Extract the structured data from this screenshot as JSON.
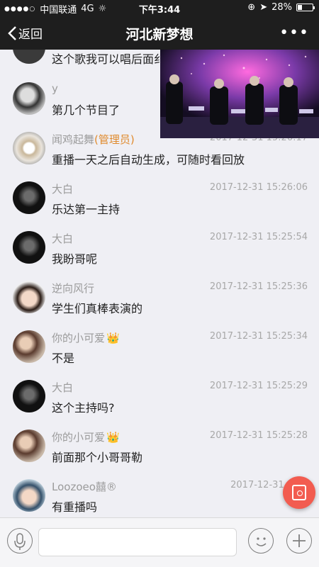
{
  "status_bar": {
    "carrier": "中国联通",
    "network": "4G",
    "time": "下午3:44",
    "battery": "28%",
    "battery_fraction": 0.28
  },
  "nav": {
    "back_label": "返回",
    "title": "河北新梦想",
    "more_label": "•••"
  },
  "messages": [
    {
      "sender": "",
      "admin_tag": "",
      "time": "",
      "text": "这个歌我可以唱后面纟"
    },
    {
      "sender": "y",
      "admin_tag": "",
      "time": "",
      "text": "第几个节目了"
    },
    {
      "sender": "闻鸡起舞",
      "admin_tag": "(管理员)",
      "time": "2017-12-31 15:26:17",
      "text": "重播一天之后自动生成，可随时看回放"
    },
    {
      "sender": "大白",
      "admin_tag": "",
      "time": "2017-12-31 15:26:06",
      "text": "乐达第一主持"
    },
    {
      "sender": "大白",
      "admin_tag": "",
      "time": "2017-12-31 15:25:54",
      "text": "我盼哥呢"
    },
    {
      "sender": "逆向风行",
      "admin_tag": "",
      "time": "2017-12-31 15:25:36",
      "text": "学生们真棒表演的"
    },
    {
      "sender": "你的小可爱",
      "admin_tag": "",
      "crown": "👑",
      "time": "2017-12-31 15:25:34",
      "text": "不是"
    },
    {
      "sender": "大白",
      "admin_tag": "",
      "time": "2017-12-31 15:25:29",
      "text": "这个主持吗?"
    },
    {
      "sender": "你的小可爱",
      "admin_tag": "",
      "crown": "👑",
      "time": "2017-12-31 15:25:28",
      "text": "前面那个小哥哥勒"
    },
    {
      "sender": "Loozoeo囍®",
      "admin_tag": "",
      "time": "2017-12-31 15:5",
      "text": "有重播吗"
    }
  ],
  "icons": {
    "back": "chevron-left-icon",
    "more": "more-dots-icon",
    "mic": "microphone-icon",
    "emoji": "emoji-icon",
    "add": "plus-icon",
    "red_packet": "red-packet-icon"
  }
}
